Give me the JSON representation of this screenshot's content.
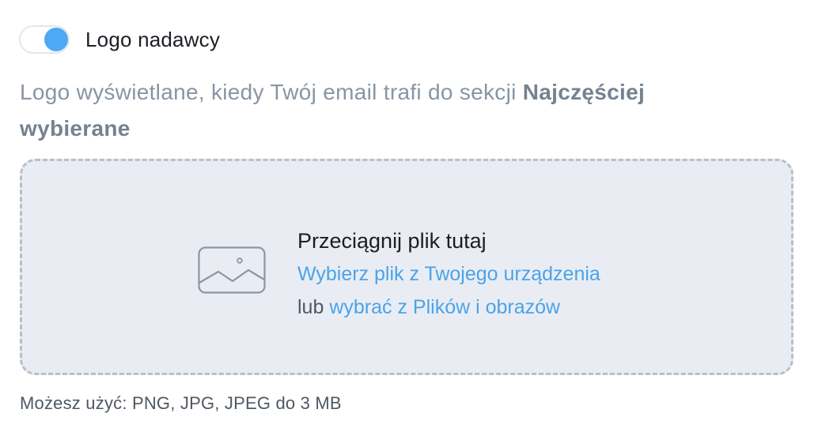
{
  "toggle": {
    "label": "Logo nadawcy",
    "on": true,
    "knob_color": "#4da9f5"
  },
  "description": {
    "text": "Logo wyświetlane, kiedy Twój email trafi do sekcji ",
    "bold": "Najczęściej wybierane"
  },
  "dropzone": {
    "icon": "image-icon",
    "title": "Przeciągnij plik tutaj",
    "choose_device_link": "Wybierz plik z Twojego urządzenia",
    "or_text": "lub",
    "choose_library_link": "wybrać z Plików i obrazów"
  },
  "hint": "Możesz użyć: PNG, JPG, JPEG do 3 MB",
  "colors": {
    "accent": "#4ba3ea",
    "dropzone_bg": "#e9edf3",
    "dropzone_border": "#b6c0c9",
    "muted_text": "#8895a3"
  }
}
